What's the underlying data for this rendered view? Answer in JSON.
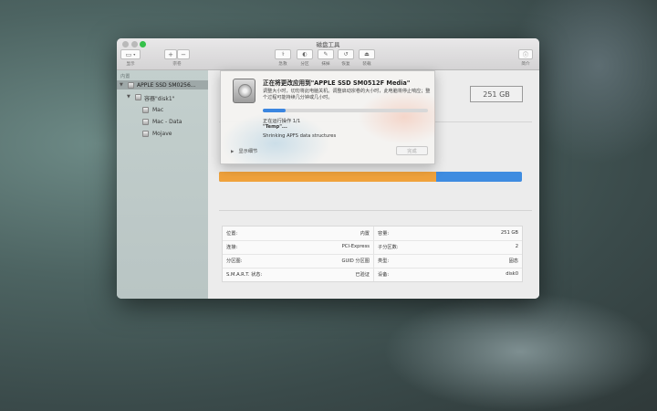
{
  "window": {
    "title": "磁盘工具"
  },
  "toolbar": {
    "view_label": "显示",
    "volume_label": "宗卷",
    "add_symbol": "+",
    "remove_symbol": "−",
    "first_aid": "急救",
    "partition": "分区",
    "erase": "抹掉",
    "restore": "恢复",
    "mount": "装载",
    "info": "简介"
  },
  "sidebar": {
    "section": "内置",
    "disk": "APPLE SSD SM0256...",
    "container": "容器\"disk1\"",
    "volumes": [
      "Mac",
      "Mac - Data",
      "Mojave"
    ]
  },
  "main": {
    "capacity_badge": "251 GB"
  },
  "info_table": {
    "rows": [
      {
        "l_label": "位置:",
        "l_value": "内置",
        "r_label": "容量:",
        "r_value": "251 GB"
      },
      {
        "l_label": "连接:",
        "l_value": "PCI-Express",
        "r_label": "子分区数:",
        "r_value": "2"
      },
      {
        "l_label": "分区图:",
        "l_value": "GUID 分区图",
        "r_label": "类型:",
        "r_value": "固态"
      },
      {
        "l_label": "S.M.A.R.T. 状态:",
        "l_value": "已验证",
        "r_label": "设备:",
        "r_value": "disk0"
      }
    ]
  },
  "sheet": {
    "title": "正在将更改应用到\"APPLE SSD SM0512F Media\"",
    "description": "调整大小时，切勿将此电脑关机。调整启动宗卷的大小时，此电脑将停止响应；整个过程可能持续几分钟或几小时。",
    "progress_fraction": 0.14,
    "operation": "正在运行操作 1/1",
    "target": "\"Temp\"...",
    "status": "Shrinking APFS data structures",
    "details_toggle": "显示细节",
    "done_button": "完成"
  },
  "colors": {
    "accent": "#3b86e0",
    "usage_orange": "#f0a23c",
    "window_close": "#b9b9b9",
    "window_maximize": "#35c04a"
  }
}
